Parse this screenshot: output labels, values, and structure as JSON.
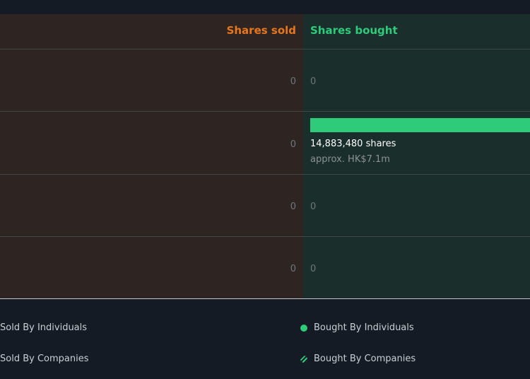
{
  "header": {
    "sold_label": "Shares sold",
    "bought_label": "Shares bought"
  },
  "colors": {
    "sold": "#e8761e",
    "bought": "#2ecb7b"
  },
  "chart_data": {
    "type": "bar",
    "series": [
      {
        "name": "Shares sold",
        "values": [
          0,
          0,
          0,
          0
        ]
      },
      {
        "name": "Shares bought",
        "values": [
          0,
          14883480,
          0,
          0
        ]
      }
    ],
    "rows": [
      {
        "sold": "0",
        "bought": "0"
      },
      {
        "sold": "0",
        "bought_shares": "14,883,480 shares",
        "bought_value": "approx. HK$7.1m"
      },
      {
        "sold": "0",
        "bought": "0"
      },
      {
        "sold": "0",
        "bought": "0"
      }
    ]
  },
  "legend": {
    "sold_individuals": "Sold By Individuals",
    "sold_companies": "Sold By Companies",
    "bought_individuals": "Bought By Individuals",
    "bought_companies": "Bought By Companies"
  }
}
